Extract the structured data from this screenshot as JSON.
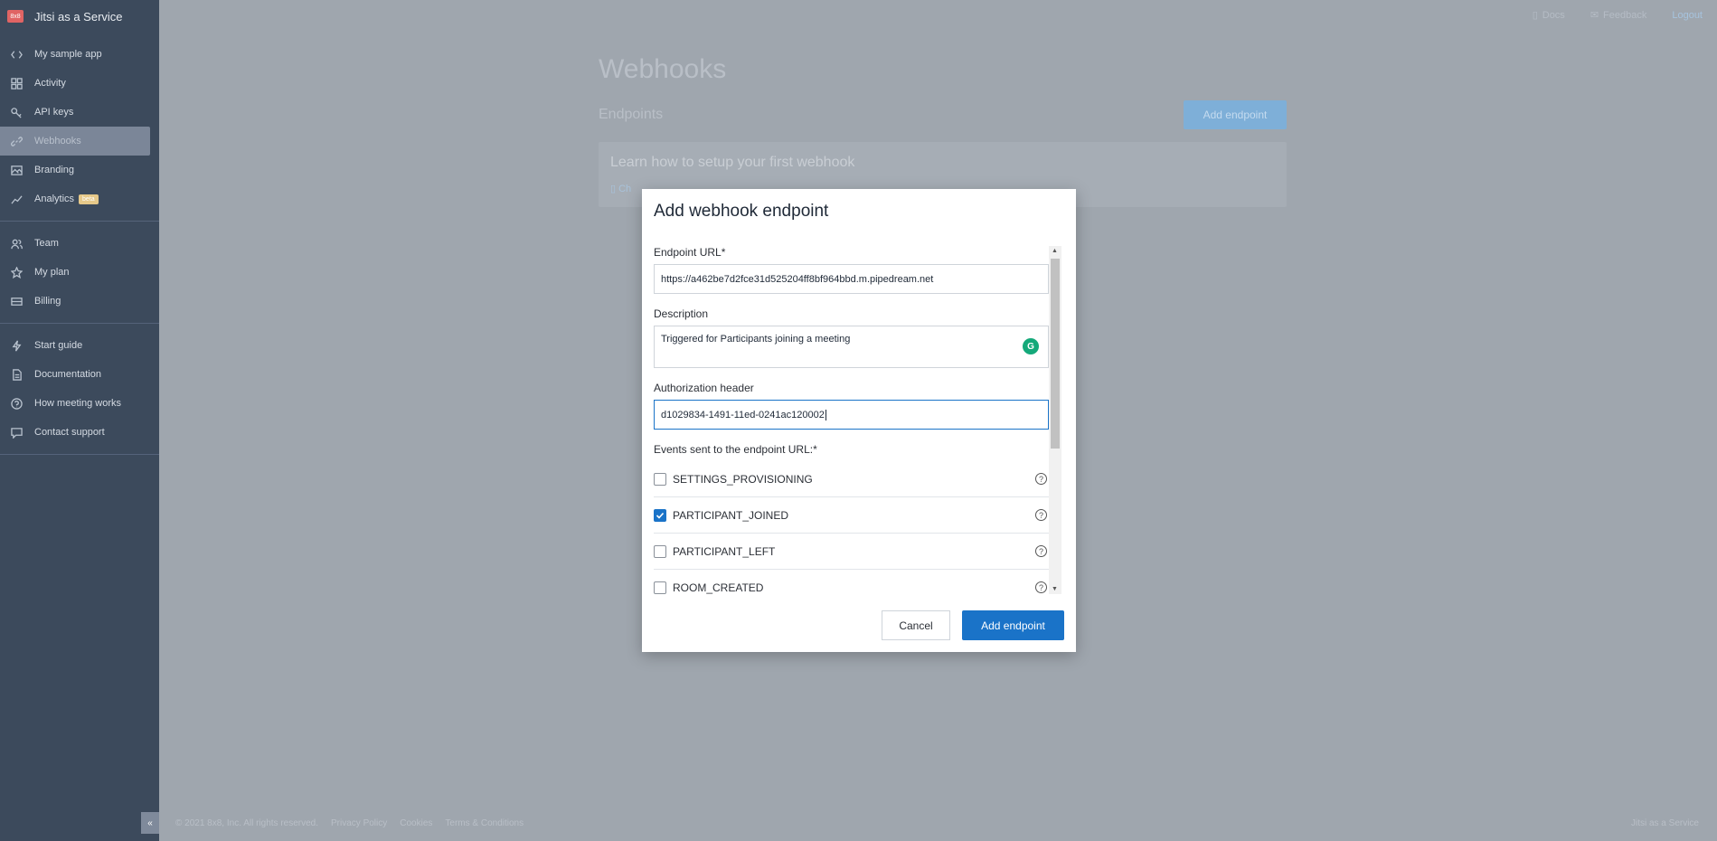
{
  "app": {
    "title": "Jitsi as a Service",
    "logo_text": "8x8"
  },
  "sidebar": {
    "groups": [
      [
        {
          "label": "My sample app",
          "icon": "code-icon"
        },
        {
          "label": "Activity",
          "icon": "grid-icon"
        },
        {
          "label": "API keys",
          "icon": "key-icon"
        },
        {
          "label": "Webhooks",
          "icon": "link-icon",
          "active": true
        },
        {
          "label": "Branding",
          "icon": "image-icon"
        },
        {
          "label": "Analytics",
          "icon": "chart-icon",
          "badge": "beta"
        }
      ],
      [
        {
          "label": "Team",
          "icon": "team-icon"
        },
        {
          "label": "My plan",
          "icon": "star-icon"
        },
        {
          "label": "Billing",
          "icon": "card-icon"
        }
      ],
      [
        {
          "label": "Start guide",
          "icon": "bolt-icon"
        },
        {
          "label": "Documentation",
          "icon": "doc-icon"
        },
        {
          "label": "How meeting works",
          "icon": "help-icon"
        },
        {
          "label": "Contact support",
          "icon": "chat-icon"
        }
      ]
    ],
    "collapse_glyph": "«"
  },
  "topbar": {
    "docs": "Docs",
    "feedback": "Feedback",
    "logout": "Logout"
  },
  "page": {
    "title": "Webhooks",
    "section": "Endpoints",
    "add_button": "Add endpoint",
    "learn_title": "Learn how to setup your first webhook",
    "learn_link": "Ch"
  },
  "footer": {
    "copyright": "© 2021 8x8, Inc. All rights reserved.",
    "privacy": "Privacy Policy",
    "cookies": "Cookies",
    "terms": "Terms & Conditions",
    "right": "Jitsi as a Service"
  },
  "modal": {
    "title": "Add webhook endpoint",
    "endpoint_label": "Endpoint URL*",
    "endpoint_value": "https://a462be7d2fce31d525204ff8bf964bbd.m.pipedream.net",
    "description_label": "Description",
    "description_value": "Triggered for Participants joining a meeting",
    "auth_label": "Authorization header",
    "auth_value": "d1029834-1491-11ed-0241ac120002",
    "events_label": "Events sent to the endpoint URL:*",
    "events": [
      {
        "name": "SETTINGS_PROVISIONING",
        "checked": false
      },
      {
        "name": "PARTICIPANT_JOINED",
        "checked": true
      },
      {
        "name": "PARTICIPANT_LEFT",
        "checked": false
      },
      {
        "name": "ROOM_CREATED",
        "checked": false
      }
    ],
    "cancel": "Cancel",
    "submit": "Add endpoint"
  }
}
